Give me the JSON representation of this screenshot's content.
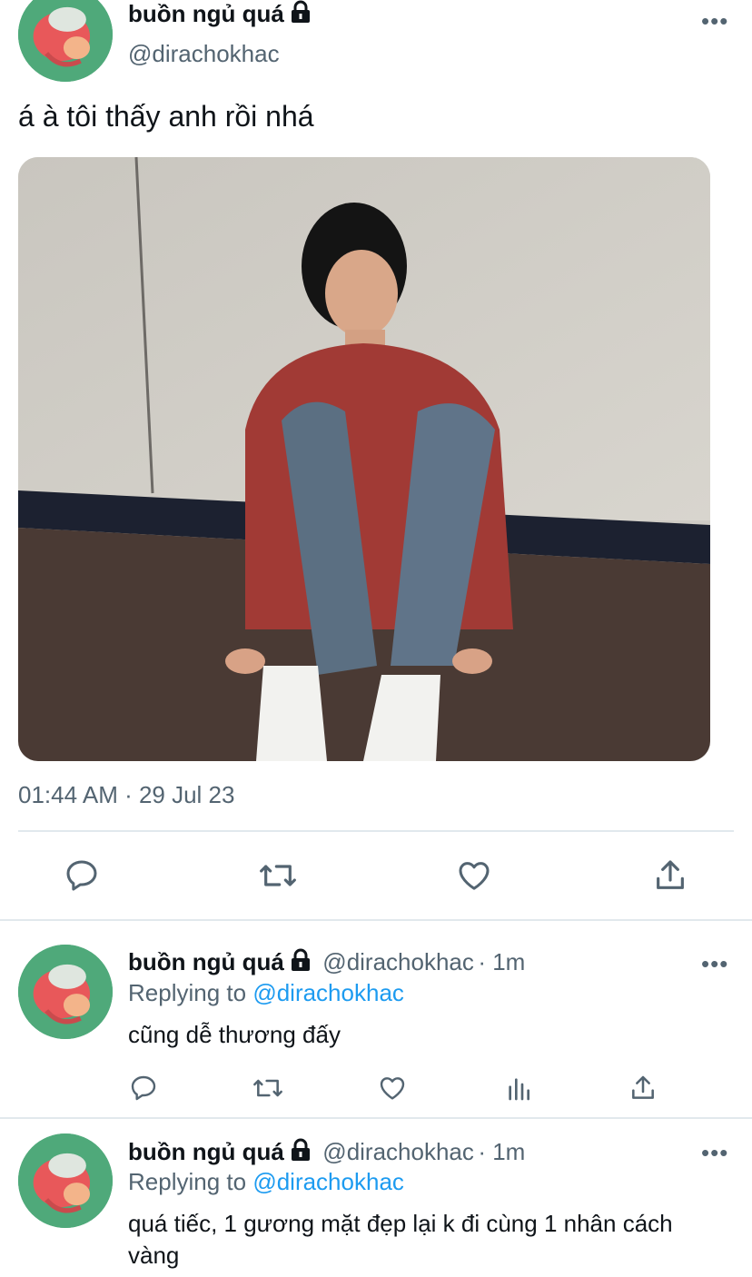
{
  "main_tweet": {
    "display_name": "buồn ngủ quá",
    "handle": "@dirachokhac",
    "text": "á à tôi thấy anh rồi nhá",
    "timestamp": "01:44 AM · 29 Jul 23",
    "more_label": "•••"
  },
  "replies": [
    {
      "display_name": "buồn ngủ quá",
      "handle": "@dirachokhac",
      "time": "· 1m",
      "replying_prefix": "Replying to",
      "replying_to": "@dirachokhac",
      "text": "cũng dễ thương đấy",
      "more_label": "•••"
    },
    {
      "display_name": "buồn ngủ quá",
      "handle": "@dirachokhac",
      "time": "· 1m",
      "replying_prefix": "Replying to",
      "replying_to": "@dirachokhac",
      "text": "quá tiếc, 1 gương mặt đẹp lại k đi cùng 1 nhân cách vàng",
      "more_label": "•••"
    }
  ],
  "icons": {
    "reply": "comment-icon",
    "retweet": "retweet-icon",
    "like": "heart-icon",
    "share": "share-icon",
    "analytics": "analytics-icon",
    "lock": "lock-icon"
  },
  "colors": {
    "link": "#1d9bf0",
    "secondary_text": "#536471",
    "avatar_bg": "#4fa97a"
  }
}
